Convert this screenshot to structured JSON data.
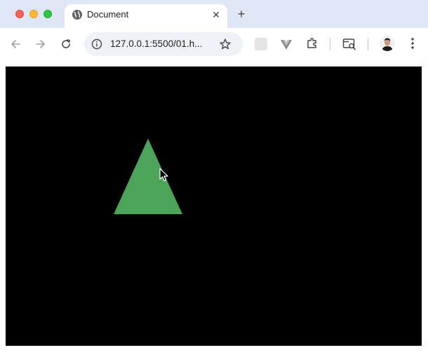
{
  "browser": {
    "tab": {
      "title": "Document",
      "favicon": "globe-icon",
      "close_icon": "close-icon"
    },
    "new_tab_icon": "plus-icon",
    "toolbar": {
      "back_icon": "back-arrow-icon",
      "forward_icon": "forward-arrow-icon",
      "reload_icon": "reload-icon",
      "url": "127.0.0.1:5500/01.h...",
      "info_icon": "info-icon",
      "bookmark_icon": "star-icon",
      "extensions": [
        "extension-square-icon",
        "vue-devtools-icon",
        "puzzle-icon"
      ],
      "tab_search_icon": "tab-search-icon",
      "profile_icon": "avatar",
      "menu_icon": "more-vertical-icon"
    },
    "traffic_lights": {
      "close_color": "#fe5f57",
      "minimize_color": "#febc2e",
      "maximize_color": "#28c840"
    }
  },
  "page": {
    "background_color": "#000000",
    "shape": {
      "type": "triangle",
      "color": "#4ca35a"
    },
    "cursor_icon": "arrow-cursor-icon"
  }
}
